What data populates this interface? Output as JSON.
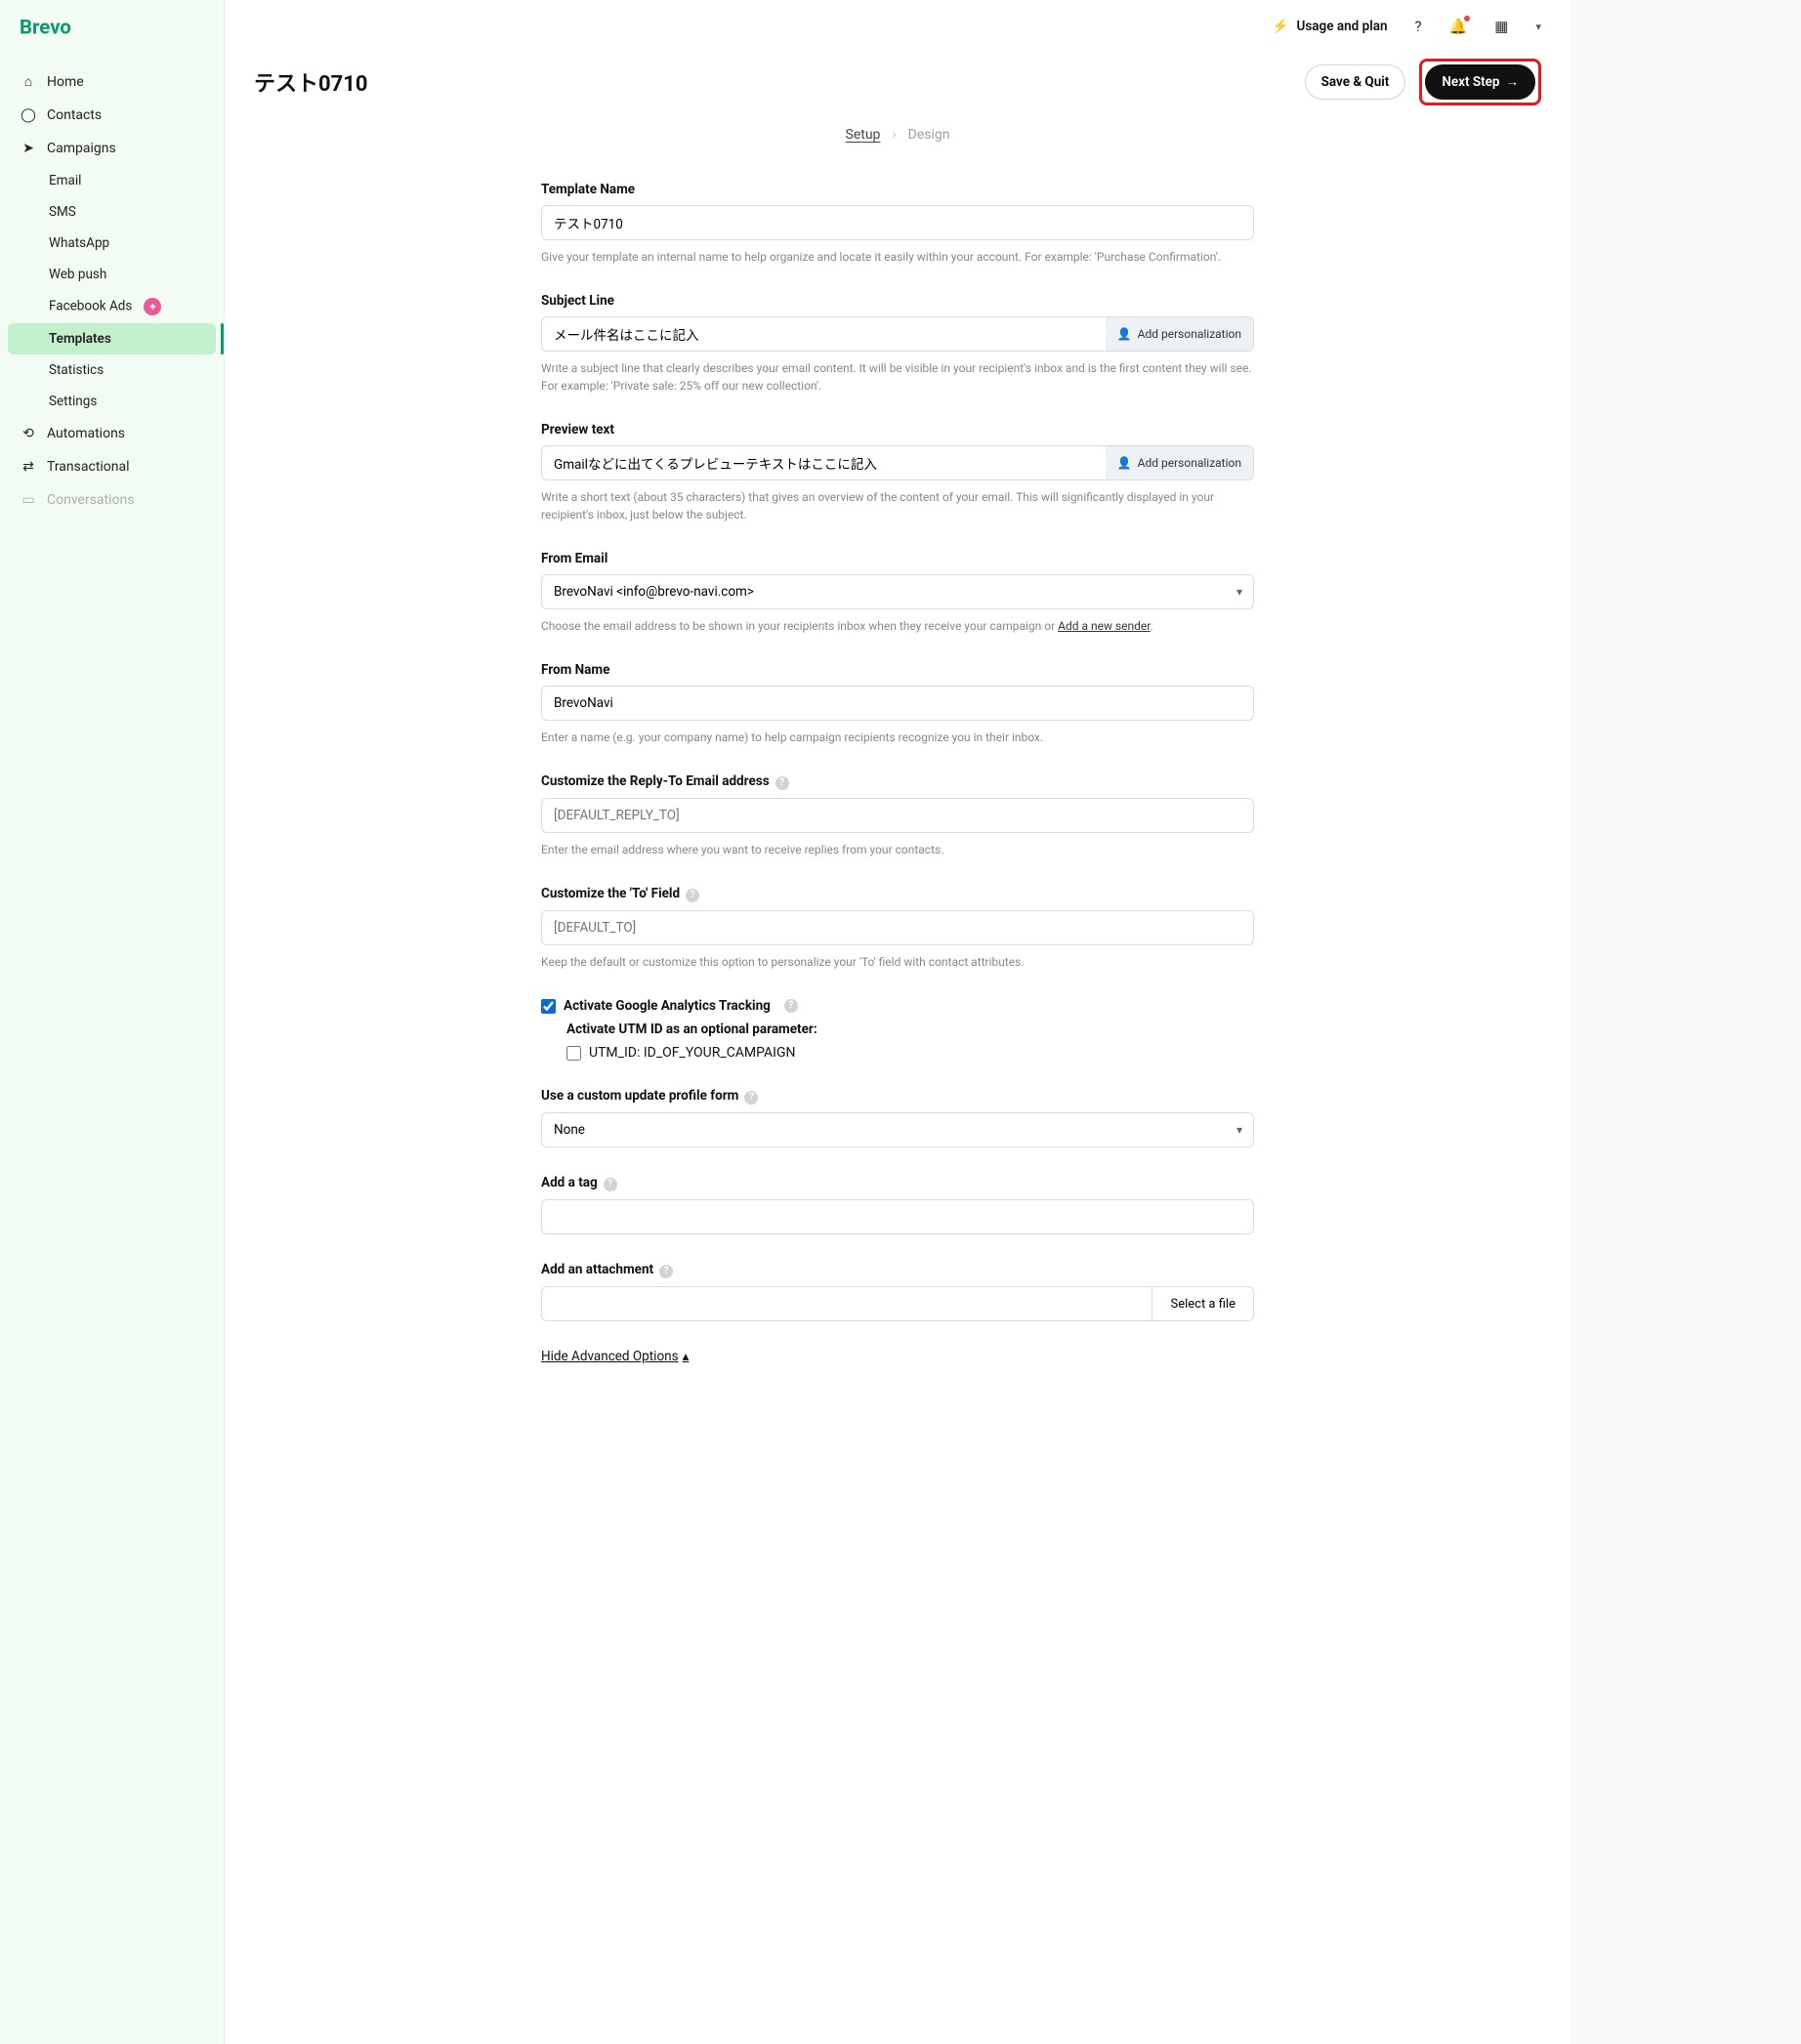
{
  "brand": "Brevo",
  "topbar": {
    "usage": "Usage and plan"
  },
  "nav": {
    "home": "Home",
    "contacts": "Contacts",
    "campaigns": "Campaigns",
    "automations": "Automations",
    "transactional": "Transactional",
    "conversations": "Conversations",
    "sub": {
      "email": "Email",
      "sms": "SMS",
      "whatsapp": "WhatsApp",
      "webpush": "Web push",
      "facebook": "Facebook Ads",
      "templates": "Templates",
      "statistics": "Statistics",
      "settings": "Settings"
    }
  },
  "header": {
    "title": "テスト0710",
    "save_quit": "Save & Quit",
    "next_step": "Next Step"
  },
  "wizard": {
    "setup": "Setup",
    "design": "Design"
  },
  "personalization_btn": "Add personalization",
  "form": {
    "template_name": {
      "label": "Template Name",
      "value": "テスト0710",
      "hint": "Give your template an internal name to help organize and locate it easily within your account. For example: 'Purchase Confirmation'."
    },
    "subject": {
      "label": "Subject Line",
      "value": "メール件名はここに記入",
      "hint": "Write a subject line that clearly describes your email content. It will be visible in your recipient's inbox and is the first content they will see. For example: 'Private sale: 25% off our new collection'."
    },
    "preview": {
      "label": "Preview text",
      "value": "Gmailなどに出てくるプレビューテキストはここに記入",
      "hint": "Write a short text (about 35 characters) that gives an overview of the content of your email. This will significantly displayed in your recipient's inbox, just below the subject."
    },
    "from_email": {
      "label": "From Email",
      "value": "BrevoNavi <info@brevo-navi.com>",
      "hint_pre": "Choose the email address to be shown in your recipients inbox when they receive your campaign or ",
      "hint_link": "Add a new sender"
    },
    "from_name": {
      "label": "From Name",
      "value": "BrevoNavi",
      "hint": "Enter a name (e.g. your company name) to help campaign recipients recognize you in their inbox."
    },
    "reply_to": {
      "label": "Customize the Reply-To Email address",
      "placeholder": "[DEFAULT_REPLY_TO]",
      "hint": "Enter the email address where you want to receive replies from your contacts."
    },
    "to_field": {
      "label": "Customize the 'To' Field",
      "placeholder": "[DEFAULT_TO]",
      "hint": "Keep the default or customize this option to personalize your 'To' field with contact attributes."
    },
    "ga": {
      "label": "Activate Google Analytics Tracking",
      "sub_head": "Activate UTM ID as an optional parameter:",
      "utm": "UTM_ID: ID_OF_YOUR_CAMPAIGN"
    },
    "profile_form": {
      "label": "Use a custom update profile form",
      "value": "None"
    },
    "tag": {
      "label": "Add a tag"
    },
    "attachment": {
      "label": "Add an attachment",
      "button": "Select a file"
    },
    "adv": "Hide Advanced Options"
  }
}
